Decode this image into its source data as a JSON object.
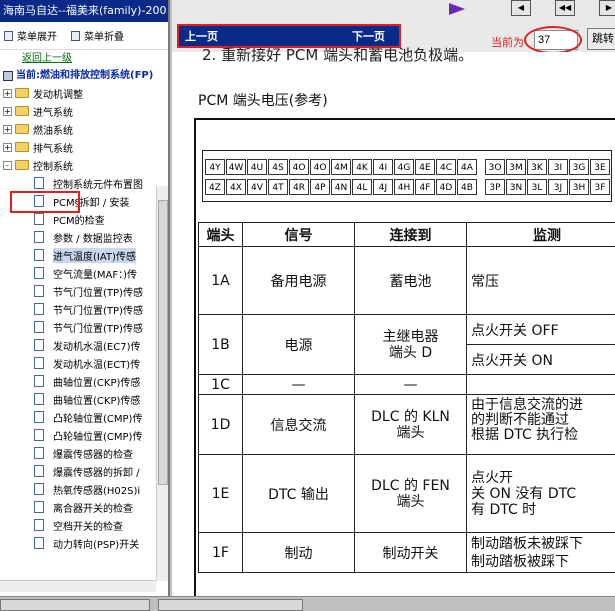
{
  "sidebar": {
    "title": "海南马自达--福美来(family)-200",
    "expand_label": "菜单展开",
    "collapse_label": "菜单折叠",
    "back_label": "返回上一级",
    "current_label": "当前:燃油和排放控制系统(FP)",
    "folders": [
      {
        "label": "发动机调整",
        "state": "+"
      },
      {
        "label": "进气系统",
        "state": "+"
      },
      {
        "label": "燃油系统",
        "state": "+"
      },
      {
        "label": "排气系统",
        "state": "+"
      },
      {
        "label": "控制系统",
        "state": "-"
      }
    ],
    "items": [
      {
        "label": "控制系统元件布置图"
      },
      {
        "label": "PCM§拆卸 / 安装"
      },
      {
        "label": "PCM的检查"
      },
      {
        "label": "参数 / 数据监控表"
      },
      {
        "label": "进气温度(IAT)传感"
      },
      {
        "label": "空气流量(MAF：)传"
      },
      {
        "label": "节气门位置(TP)传感"
      },
      {
        "label": "节气门位置(TP)传感"
      },
      {
        "label": "节气门位置(TP)传感"
      },
      {
        "label": "发动机水温(EC7)传"
      },
      {
        "label": "发动机水温(ECT)传"
      },
      {
        "label": "曲轴位置(CKP)传感"
      },
      {
        "label": "曲轴位置(CKP)传感"
      },
      {
        "label": "凸轮轴位置(CMP)传"
      },
      {
        "label": "凸轮轴位置(CMP)传"
      },
      {
        "label": "爆震传感器的检查"
      },
      {
        "label": "爆震传感器的拆卸 /"
      },
      {
        "label": "热氧传感器(H02S)i"
      },
      {
        "label": "离合器开关的检查"
      },
      {
        "label": "空档开关的检查"
      },
      {
        "label": "动力转向(PSP)开关"
      }
    ]
  },
  "nav": {
    "prev_label": "上一页",
    "next_label": "下一页"
  },
  "page": {
    "label": "当前为",
    "value": "37",
    "go_label": "跳转"
  },
  "doc": {
    "step_text": "2. 重新接好 PCM 端头和蓄电池负极端。",
    "pcm_title": "PCM 端头电压(参考)",
    "pins_top": [
      "4Y",
      "4W",
      "4U",
      "4S",
      "4O",
      "4O",
      "4M",
      "4K",
      "4I",
      "4G",
      "4E",
      "4C",
      "4A",
      "3O",
      "3M",
      "3K",
      "3I",
      "3G",
      "3E"
    ],
    "pins_bottom": [
      "4Z",
      "4X",
      "4V",
      "4T",
      "4R",
      "4P",
      "4N",
      "4L",
      "4J",
      "4H",
      "4F",
      "4D",
      "4B",
      "3P",
      "3N",
      "3L",
      "3J",
      "3H",
      "3F"
    ],
    "headers": [
      "端头",
      "信号",
      "连接到",
      "监测"
    ],
    "rows": [
      {
        "pin": "1A",
        "signal": "备用电源",
        "conn": "蓄电池",
        "cond": "常压",
        "cond2": ""
      },
      {
        "pin": "1B",
        "signal": "电源",
        "conn": "主继电器\n端头 D",
        "cond": "点火开关 OFF",
        "cond2": "点火开关 ON"
      },
      {
        "pin": "1C",
        "signal": "—",
        "conn": "—",
        "cond": "",
        "cond2": ""
      },
      {
        "pin": "1D",
        "signal": "信息交流",
        "conn": "DLC 的 KLN\n端头",
        "cond": "由于信息交流的进",
        "cond2": "的判断不能通过\n根据 DTC 执行检"
      },
      {
        "pin": "1E",
        "signal": "DTC 输出",
        "conn": "DLC 的 FEN\n端头",
        "cond": "点火开\n关 ON",
        "cond2": "没有 DTC\n有 DTC 时"
      },
      {
        "pin": "1F",
        "signal": "制动",
        "conn": "制动开关",
        "cond": "制动踏板未被踩下",
        "cond2": "制动踏板被踩下"
      }
    ]
  }
}
